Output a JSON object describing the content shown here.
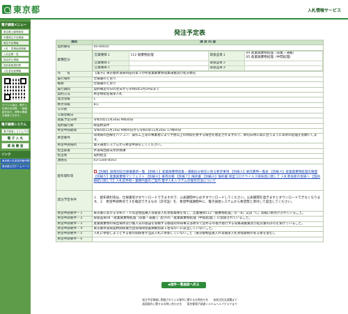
{
  "header": {
    "logo_text": "東京都",
    "right_title": "入札情報サービス"
  },
  "sidebar": {
    "heading_menu": "電子調達メニュー",
    "links": [
      "東京都公報等検索",
      "年間発注予定情報",
      "発注予定情報",
      "入札・見積経過情報",
      "入札結果一覧",
      "指名停止情報",
      "契約事務規則等",
      "入札参加者情報"
    ],
    "mobile_note": "モバイル版は、電子入札等の利用等、一部機能を除き、同等の情報を検索できます。",
    "heading_system": "電子調達システム",
    "system_link": "電子調達システム(TOP)",
    "buttons": [
      "電 子 入 札",
      "資 格 審 査"
    ],
    "heading_links": "リンク",
    "blue_links": [
      "東京都入札参加資格申請",
      "東京都公式ホームページ"
    ]
  },
  "page": {
    "title": "発注予定表"
  },
  "table": {
    "col_item": "項目",
    "col_content": "項 目 内 容",
    "rows": [
      {
        "label": "契約番号",
        "value": "05-00035"
      },
      {
        "label": "作　　名",
        "value": "【電子】東京都水道局和田内第３か所産業廃棄物収集運搬及び処分委託"
      },
      {
        "label": "履行場所",
        "value": "仕様書のとおり"
      },
      {
        "label": "概要",
        "value": "仕様書のとおり"
      },
      {
        "label": "履行期間",
        "value": "契約確定の日の翌日から令和6年2月29日まで"
      },
      {
        "label": "契約方法",
        "value": "希望制指名競争入札"
      },
      {
        "label": "発注等級",
        "value": "C"
      },
      {
        "label": "格付等級",
        "value": "B,C"
      },
      {
        "label": "その他",
        "value": ""
      },
      {
        "label": "公報登載日",
        "value": ""
      },
      {
        "label": "閲覧予定日時",
        "value": "令和5年11月30日 9時30分"
      },
      {
        "label": "契約履行期",
        "value": "総契約案件"
      },
      {
        "label": "希望申請期間",
        "value": "令和5年11月14日 9時00分から令和5年11月20日 17時00分"
      },
      {
        "label": "希望要件",
        "value": "環境局の回線をパソコン、操作工上等の事業者により予想以上の時間を要する場合も想定されますので、締切日時に間に合うように早めの処理をお願いします。"
      },
      {
        "label": "希望申請場所",
        "value": "電子調達システムから希望申請をしてください。"
      },
      {
        "label": "担当部署",
        "value": "水道局西部支所庶務課"
      },
      {
        "label": "担当者",
        "value": "契約担当"
      },
      {
        "label": "連絡先",
        "value": "03-5300-8503"
      }
    ],
    "kind_label": "業種区分",
    "kinds": [
      {
        "left_head": "営業種目１",
        "left_val": "112 廃棄物処理",
        "right_head": "取扱品目１",
        "right_val": "04 産業廃棄物処理（収集・運搬）\n05 産業廃棄物処理（中間処理）"
      },
      {
        "left_head": "営業種目２",
        "left_val": "",
        "right_head": "取扱品目２",
        "right_val": ""
      },
      {
        "left_head": "営業種目３",
        "left_val": "",
        "right_head": "取扱品目３",
        "right_val": ""
      }
    ],
    "files_label": "配布資料等",
    "files_text": "【別紙】調達別記仕様書最新一覧  【別紙１】産業廃棄物収集・運搬処分委託に係る要求事項  【別紙３】委託費用一覧表  【別紙４】産業廃棄物処理の数量  【別紙５】産業廃棄物マニフェスト  【別紙６】車両台帳  【別紙７】陳述書  【別紙８】誓約書  新型コロナウイルス感染症に関して  入札参加者の皆様へ  【契約締結に関して】入札前手続・業務内容のご案内  電子入札システムの操作方法について",
    "conditions_label": "発注予定条件",
    "conditions_text": "１　配布資料等は、仕様書等がダウンロードできますので、公表期間中に必ずダウンロードしてください。公表期間を過ぎますとダウンロードできなくなります。２　希望申請時点で３を確認できるもの（許可証）を、希望申請期間中に、電子調達システムから希望票と添付して提出してください。",
    "req_rows": [
      {
        "label": "希望申請要件－１",
        "value": "東京都における令和５・６年度物品購入等競争入札参加資格を有し、営業種目112「廃棄物処理」の「B」又は「C」等級に格付けされていること。"
      },
      {
        "label": "希望申請要件－２",
        "value": "取扱品目04「産業廃棄物処理（収集・運搬）」及び05「産業廃棄物処理（中間処理）」に登録されていること。"
      },
      {
        "label": "希望申請要件－３",
        "value": "産業廃棄物の排出場所及び搬入先の施設を管轄する都道府県知事又は政令で定める市長が発行する収集運搬業及び処分業の許可を受けていること。"
      },
      {
        "label": "希望申請要件－４",
        "value": "東京都水道局契約関係暴力団等排除措置要綱別表１各号の一に該当していないこと。"
      },
      {
        "label": "希望申請要件－５",
        "value": "入札に参加しようとする者の関係者が当該入札に参加していないこと（東京都物品買入れ等競争入札参加資格の有る者を含む）。"
      },
      {
        "label": "希望申請要件－６",
        "value": ""
      }
    ]
  },
  "back_button": "◆案件一覧画面へ戻る",
  "footer": {
    "line1": "発注予定情報に掲載されている案件に関するお問合せ先　　各発注担当部署まで",
    "line2": "画面操作に関するお問い合わせ先　　東京都電子調達システムヘルプデスクまで"
  }
}
